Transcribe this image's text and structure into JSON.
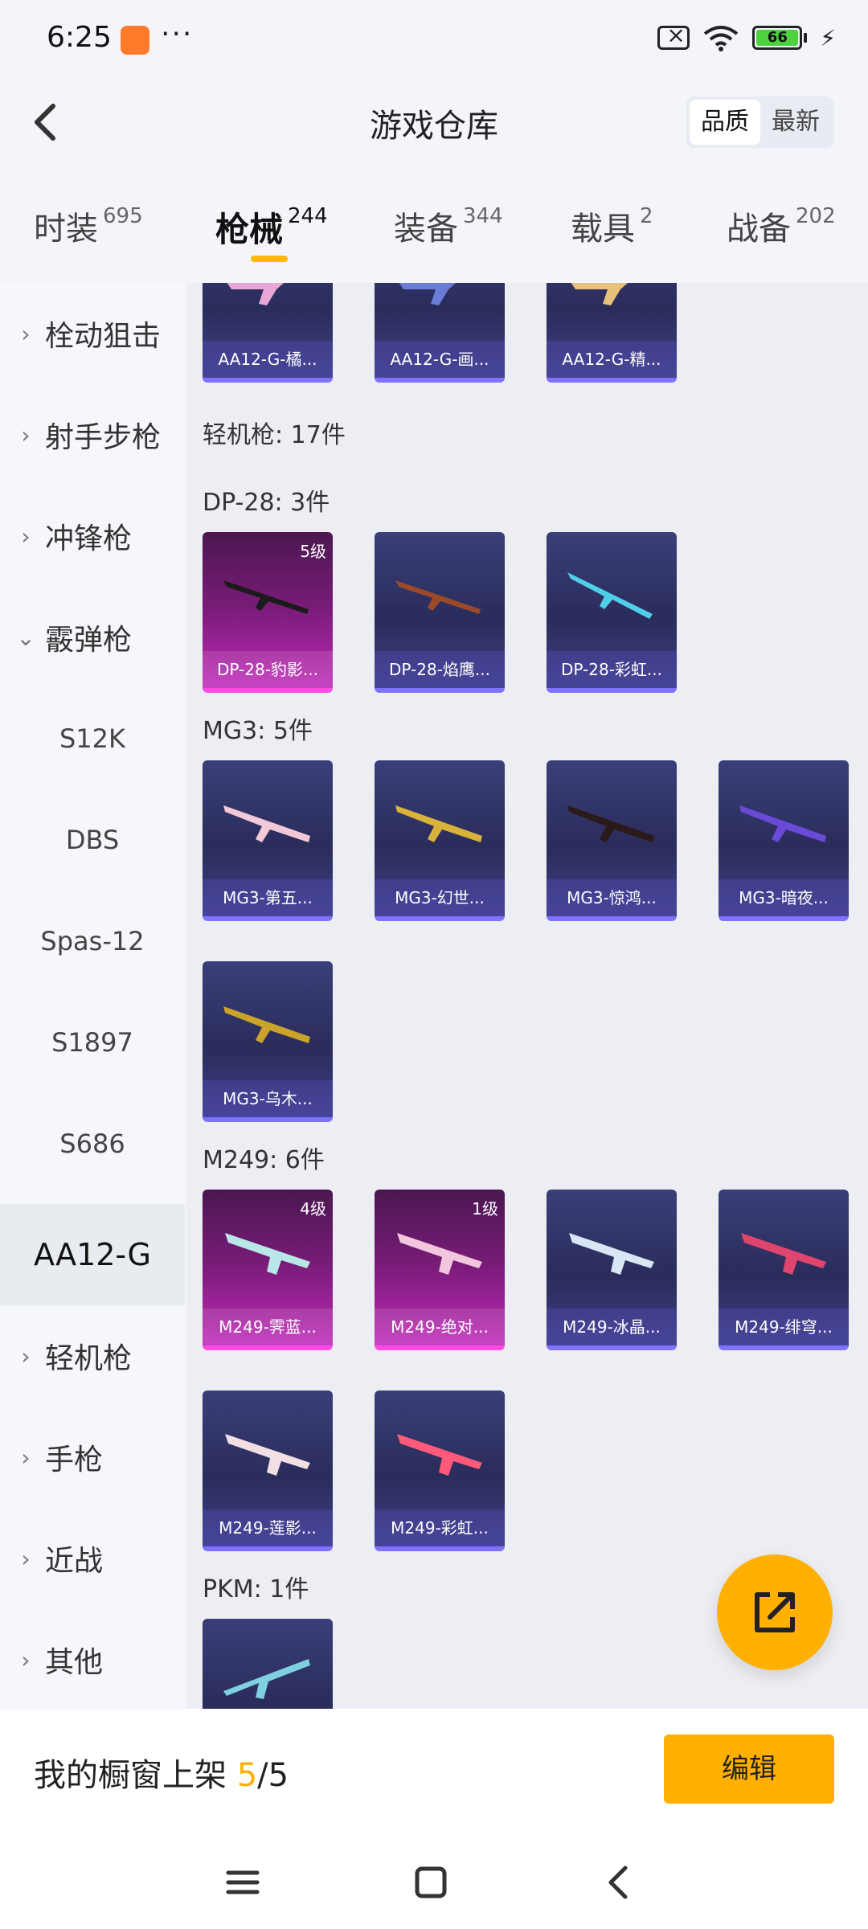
{
  "status": {
    "time": "6:25",
    "dots": "···",
    "battery": "66"
  },
  "header": {
    "title": "游戏仓库",
    "sort": [
      "品质",
      "最新"
    ]
  },
  "tabs": [
    {
      "label": "时装",
      "count": "695"
    },
    {
      "label": "枪械",
      "count": "244"
    },
    {
      "label": "装备",
      "count": "344"
    },
    {
      "label": "载具",
      "count": "2"
    },
    {
      "label": "战备",
      "count": "202"
    }
  ],
  "sidebar": {
    "items": [
      "栓动狙击",
      "射手步枪",
      "冲锋枪",
      "霰弹枪",
      "S12K",
      "DBS",
      "Spas-12",
      "S1897",
      "S686",
      "AA12-G",
      "轻机枪",
      "手枪",
      "近战",
      "其他"
    ]
  },
  "content": {
    "top_cards": [
      "AA12-G-橘...",
      "AA12-G-画...",
      "AA12-G-精..."
    ],
    "lmg_header": "轻机枪: 17件",
    "dp28": {
      "label": "DP-28: 3件",
      "cards": [
        "DP-28-豹影...",
        "DP-28-焰鹰...",
        "DP-28-彩虹..."
      ],
      "level0": "5级"
    },
    "mg3": {
      "label": "MG3: 5件",
      "cards": [
        "MG3-第五...",
        "MG3-幻世...",
        "MG3-惊鸿...",
        "MG3-暗夜...",
        "MG3-乌木..."
      ]
    },
    "m249": {
      "label": "M249: 6件",
      "cards": [
        "M249-霁蓝...",
        "M249-绝对...",
        "M249-冰晶...",
        "M249-绯穹...",
        "M249-莲影...",
        "M249-彩虹..."
      ],
      "level0": "4级",
      "level1": "1级"
    },
    "pkm": {
      "label": "PKM: 1件"
    }
  },
  "bottom": {
    "shelf_label": "我的橱窗上架 ",
    "shelf_used": "5",
    "shelf_total": "/5",
    "edit": "编辑"
  },
  "colors": {
    "accent": "#ffb000",
    "card_blue": "#2a2c5a",
    "card_pink": "#c02ab8"
  }
}
